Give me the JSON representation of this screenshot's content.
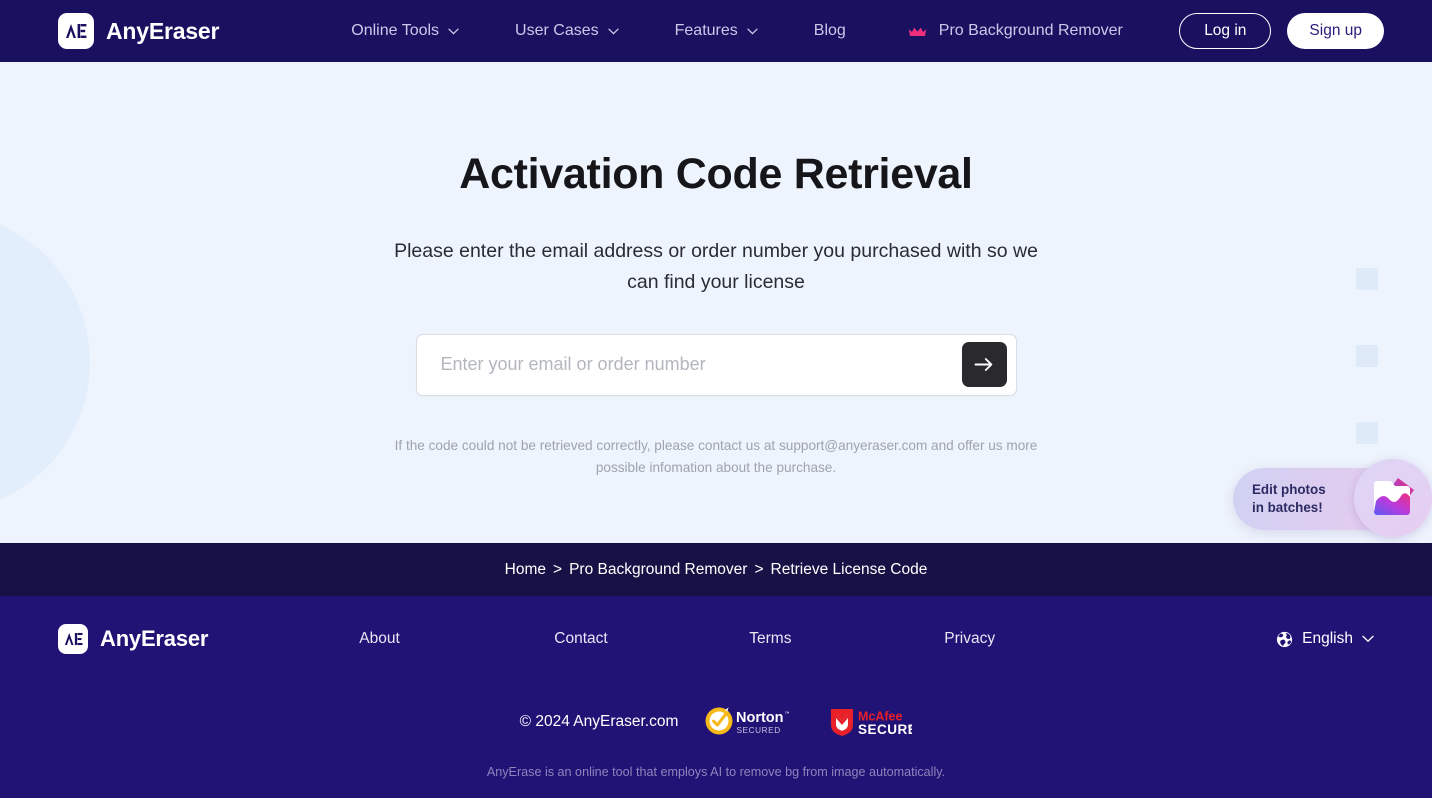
{
  "nav": {
    "brand": {
      "name": "AnyEraser",
      "logo_icon": "ae-logo-icon"
    },
    "items": [
      {
        "label": "Online Tools",
        "has_dropdown": true
      },
      {
        "label": "User Cases",
        "has_dropdown": true
      },
      {
        "label": "Features",
        "has_dropdown": true
      },
      {
        "label": "Blog",
        "has_dropdown": false
      }
    ],
    "pro": {
      "label": "Pro Background Remover",
      "icon": "pro-crown-icon"
    },
    "login_label": "Log in",
    "signup_label": "Sign up"
  },
  "hero": {
    "title": "Activation Code Retrieval",
    "subtitle": "Please enter the email address or order number you purchased with so we can find your license",
    "search": {
      "placeholder": "Enter your email or order number",
      "value": "",
      "submit_icon": "arrow-right-icon"
    },
    "note": "If the code could not be retrieved correctly, please contact us at support@anyeraser.com and offer us more possible infomation about the purchase."
  },
  "float_widget": {
    "text": "Edit photos\nin batches!",
    "icon": "photo-stack-icon"
  },
  "breadcrumb": {
    "separator": ">",
    "items": [
      "Home",
      "Pro Background Remover",
      "Retrieve License Code"
    ]
  },
  "footer": {
    "brand": {
      "name": "AnyEraser",
      "logo_icon": "ae-logo-icon"
    },
    "links": [
      "About",
      "Contact",
      "Terms",
      "Privacy"
    ],
    "language": {
      "label": "English",
      "icon": "globe-icon",
      "chevron": "chevron-down-icon"
    },
    "copyright": "© 2024 AnyEraser.com",
    "badges": [
      {
        "name": "norton-secured-badge",
        "title": "Norton",
        "subtitle": "SECURED"
      },
      {
        "name": "mcafee-secure-badge",
        "title": "McAfee",
        "subtitle": "SECURE"
      }
    ],
    "tagline": "AnyErase is an online tool that employs AI to remove bg from image automatically."
  },
  "colors": {
    "nav_bg": "#1a1060",
    "hero_bg": "#eef4fd",
    "breadcrumb_bg": "#181146",
    "footer_bg": "#211275",
    "accent_pink": "#ef2f7e",
    "submit_dark": "#2a2a2e"
  }
}
